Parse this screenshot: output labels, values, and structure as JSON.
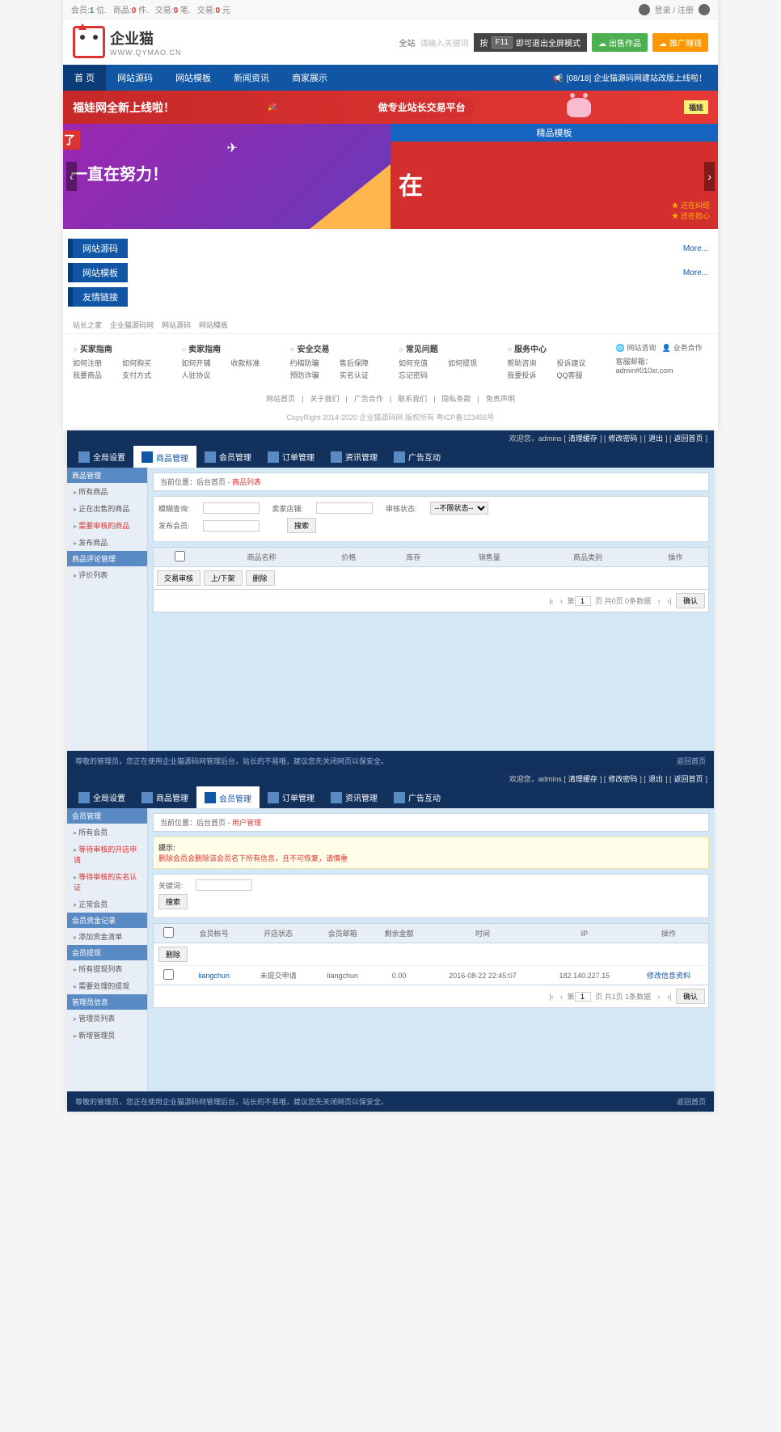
{
  "panel1": {
    "topbar": {
      "stats": [
        {
          "label": "会员:",
          "val": "1",
          "suffix": "位."
        },
        {
          "label": "商品:",
          "val": "0",
          "suffix": "件."
        },
        {
          "label": "交易:",
          "val": "0",
          "suffix": "笔."
        },
        {
          "label": "交易:",
          "val": "0",
          "suffix": "元"
        }
      ],
      "login": "登录 / 注册"
    },
    "logo": {
      "big": "企业猫",
      "small": "WWW.QYMAO.CN"
    },
    "search_label": "全站",
    "search_placeholder": "请输入关键词",
    "f11": {
      "pre": "按",
      "key": "F11",
      "post": "即可退出全屏模式"
    },
    "btn_green": "出售作品",
    "btn_orange": "推广赚钱",
    "nav": [
      "首 页",
      "网站源码",
      "网站模板",
      "新闻资讯",
      "商家展示"
    ],
    "announce": "[08/18] 企业猫源码网建站改版上线啦！",
    "banner_red": {
      "left": "福娃网全新上线啦！",
      "right": "做专业站长交易平台",
      "tag": "福娃"
    },
    "carousel": {
      "left_badge": "了",
      "left_text": "一直在努力！",
      "right_head": "精品模板",
      "right_text": "在",
      "star1": "还在纠结",
      "star2": "还在担心"
    },
    "sections": [
      {
        "title": "网站源码",
        "more": "More..."
      },
      {
        "title": "网站模板",
        "more": "More..."
      },
      {
        "title": "友情链接"
      }
    ],
    "links": [
      "站长之家",
      "企业猫源码网",
      "网站源码",
      "网站模板"
    ],
    "footer_cols": [
      {
        "title": "买家指南",
        "items": [
          "如何注册",
          "如何购买",
          "我要商品",
          "支付方式"
        ]
      },
      {
        "title": "卖家指南",
        "items": [
          "如何开铺",
          "收款标准",
          "人驻协议",
          ""
        ]
      },
      {
        "title": "安全交易",
        "items": [
          "约稿防骗",
          "售后保障",
          "预防诈骗",
          "实名认证"
        ]
      },
      {
        "title": "常见问题",
        "items": [
          "如何充值",
          "如何提现",
          "忘记密码",
          ""
        ]
      },
      {
        "title": "服务中心",
        "items": [
          "帮助咨询",
          "投诉建议",
          "我要投诉",
          "QQ客服"
        ]
      }
    ],
    "footer_right": {
      "site": "网站咨询",
      "biz": "业务合作",
      "email": "客服邮箱：admin#010xr.com"
    },
    "bottom_links": [
      "网站首页",
      "关于我们",
      "广告合作",
      "联系我们",
      "隐私条款",
      "免责声明"
    ],
    "copyright": "CopyRight 2014-2020 企业猫源码网 版权所有 粤ICP备123456号"
  },
  "panel2": {
    "welcome": "欢迎您，admins",
    "top_links": [
      "清理缓存",
      "修改密码",
      "退出",
      "返回首页"
    ],
    "tabs": [
      "全局设置",
      "商品管理",
      "会员管理",
      "订单管理",
      "资讯管理",
      "广告互动"
    ],
    "active_tab": 1,
    "side_groups": [
      {
        "title": "商品管理",
        "items": [
          {
            "t": "所有商品"
          },
          {
            "t": "正在出售的商品"
          },
          {
            "t": "需要审核的商品",
            "red": true
          },
          {
            "t": "发布商品"
          }
        ]
      },
      {
        "title": "商品评论管理",
        "items": [
          {
            "t": "评价列表"
          }
        ]
      }
    ],
    "breadcrumb_pre": "当前位置：后台首页 - ",
    "breadcrumb_cur": "商品列表",
    "filters": [
      {
        "label": "模糊查询:"
      },
      {
        "label": "卖家店铺:"
      },
      {
        "label": "审核状态:",
        "select": "--不限状态--"
      }
    ],
    "filter_row2": [
      {
        "label": "发布会员:"
      }
    ],
    "btn_search": "搜索",
    "cols": [
      "",
      "商品名称",
      "价格",
      "库存",
      "销售量",
      "商品类别",
      "操作"
    ],
    "actions": [
      "交易审核",
      "上/下架",
      "删除"
    ],
    "pager": {
      "page": "1",
      "suffix": "页  共0页 0条数据",
      "go": "确认"
    },
    "footer_left": "尊敬的管理员，您正在使用企业猫源码网管理后台，站长的不易哦，建议您先关闭网页以保安全。",
    "footer_right": "返回首页"
  },
  "panel3": {
    "welcome": "欢迎您，admins",
    "top_links": [
      "清理缓存",
      "修改密码",
      "退出",
      "返回首页"
    ],
    "tabs": [
      "全局设置",
      "商品管理",
      "会员管理",
      "订单管理",
      "资讯管理",
      "广告互动"
    ],
    "active_tab": 2,
    "side_groups": [
      {
        "title": "会员管理",
        "items": [
          {
            "t": "所有会员"
          },
          {
            "t": "等待审核的开店申请",
            "red": true
          },
          {
            "t": "等待审核的实名认证",
            "red": true
          },
          {
            "t": "正常会员"
          }
        ]
      },
      {
        "title": "会员资金记录",
        "items": [
          {
            "t": "添加资金清单"
          }
        ]
      },
      {
        "title": "会员提现",
        "items": [
          {
            "t": "所有提现列表"
          },
          {
            "t": "需要处理的提现"
          }
        ]
      },
      {
        "title": "管理员信息",
        "items": [
          {
            "t": "管理员列表"
          },
          {
            "t": "新增管理员"
          }
        ]
      }
    ],
    "breadcrumb_pre": "当前位置：后台首页 - ",
    "breadcrumb_cur": "用户管理",
    "alert": {
      "title": "提示:",
      "body": "删除会员会删除该会员名下所有信息，且不可恢复，请慎重"
    },
    "filters": [
      {
        "label": "关键词:"
      }
    ],
    "btn_search": "搜索",
    "cols": [
      "",
      "会员帐号",
      "开店状态",
      "会员邮箱",
      "剩余金额",
      "时间",
      "IP",
      "操作"
    ],
    "btn_del": "删除",
    "rows": [
      {
        "user": "liangchun",
        "shop": "未提交申请",
        "email": "liangchun",
        "bal": "0.00",
        "time": "2016-08-22 22:45:07",
        "ip": "182.140.227.15",
        "op": "修改信息资料"
      }
    ],
    "pager": {
      "page": "1",
      "suffix": "页  共1页 1条数据",
      "go": "确认"
    },
    "footer_left": "尊敬的管理员，您正在使用企业猫源码网管理后台，站长的不易哦，建议您先关闭网页以保安全。",
    "footer_right": "返回首页"
  }
}
